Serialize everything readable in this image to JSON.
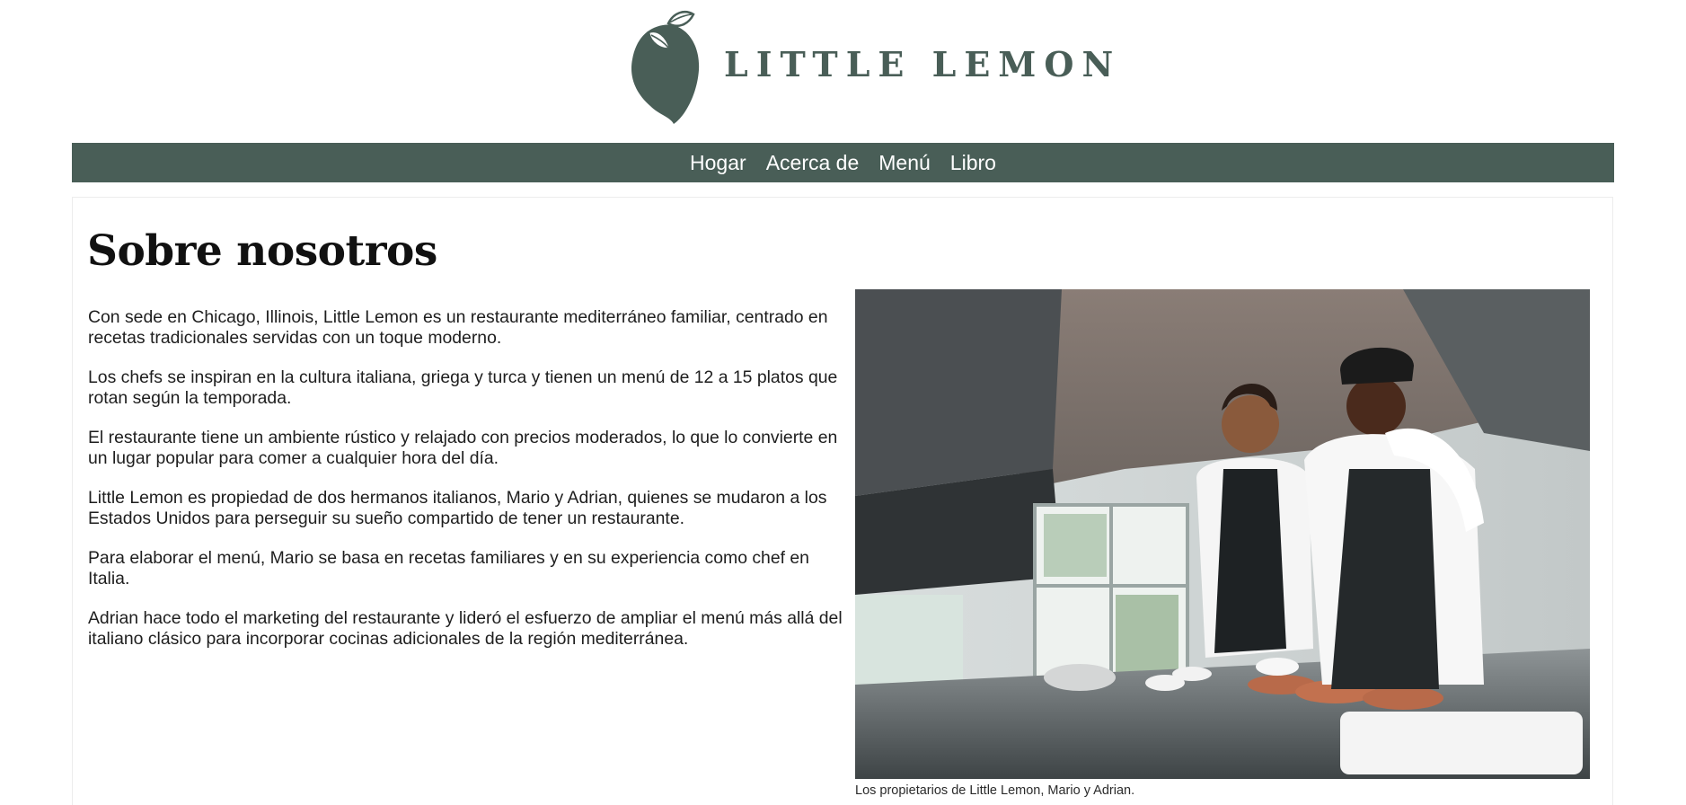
{
  "brand": {
    "name": "LITTLE LEMON",
    "logo_icon": "lemon-icon",
    "color": "#495e57"
  },
  "nav": {
    "items": [
      {
        "label": "Hogar"
      },
      {
        "label": "Acerca de"
      },
      {
        "label": "Menú"
      },
      {
        "label": "Libro"
      }
    ],
    "background": "#495e57"
  },
  "main": {
    "title": "Sobre nosotros",
    "paragraphs": [
      "Con sede en Chicago, Illinois, Little Lemon es un restaurante mediterráneo familiar, centrado en recetas tradicionales servidas con un toque moderno.",
      "Los chefs se inspiran en la cultura italiana, griega y turca y tienen un menú de 12 a 15 platos que rotan según la temporada.",
      "El restaurante tiene un ambiente rústico y relajado con precios moderados, lo que lo convierte en un lugar popular para comer a cualquier hora del día.",
      "Little Lemon es propiedad de dos hermanos italianos, Mario y Adrian, quienes se mudaron a los Estados Unidos para perseguir su sueño compartido de tener un restaurante.",
      "Para elaborar el menú, Mario se basa en recetas familiares y en su experiencia como chef en Italia.",
      "Adrian hace todo el marketing del restaurante y lideró el esfuerzo de ampliar el menú más allá del italiano clásico para incorporar cocinas adicionales de la región mediterránea."
    ],
    "figure": {
      "caption": "Los propietarios de Little Lemon, Mario y Adrian."
    }
  }
}
